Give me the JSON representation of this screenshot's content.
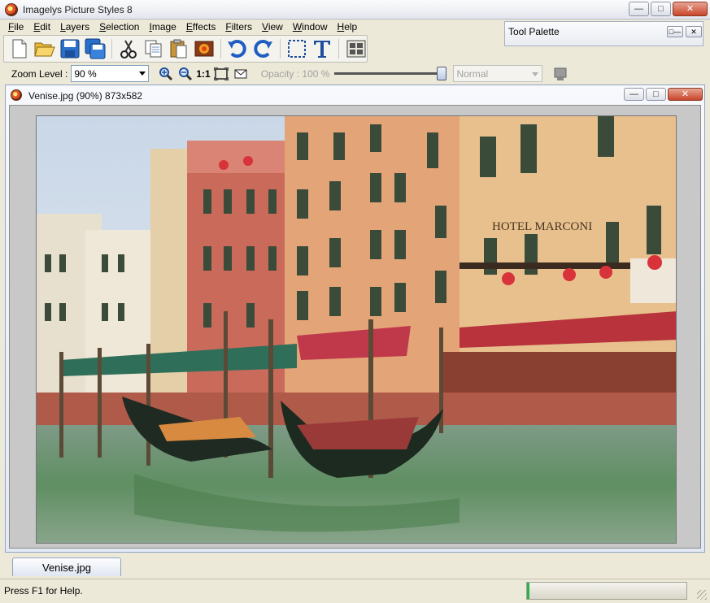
{
  "app": {
    "title": "Imagelys Picture Styles 8",
    "icon": "app-logo-icon"
  },
  "menu": [
    {
      "label": "File",
      "underline": "F",
      "rest": "ile"
    },
    {
      "label": "Edit",
      "underline": "E",
      "rest": "dit"
    },
    {
      "label": "Layers",
      "underline": "L",
      "rest": "ayers"
    },
    {
      "label": "Selection",
      "underline": "S",
      "rest": "election"
    },
    {
      "label": "Image",
      "underline": "I",
      "rest": "mage"
    },
    {
      "label": "Effects",
      "underline": "E",
      "rest": "ffects"
    },
    {
      "label": "Filters",
      "underline": "F",
      "rest": "ilters"
    },
    {
      "label": "View",
      "underline": "V",
      "rest": "iew"
    },
    {
      "label": "Window",
      "underline": "W",
      "rest": "indow"
    },
    {
      "label": "Help",
      "underline": "H",
      "rest": "elp"
    }
  ],
  "palette": {
    "title": "Tool Palette"
  },
  "toolbar": {
    "buttons": [
      "new-file",
      "open-folder",
      "save",
      "save-all",
      "cut",
      "copy",
      "paste",
      "insert-image",
      "undo",
      "redo",
      "selection-rect",
      "text",
      "arrange"
    ]
  },
  "zoom": {
    "label": "Zoom Level :",
    "value": "90 %",
    "one_to_one": "1:1"
  },
  "opacity": {
    "label": "Opacity : 100 %",
    "value_percent": 100
  },
  "blend": {
    "value": "Normal"
  },
  "document": {
    "title": "Venise.jpg (90%) 873x582"
  },
  "tabs": [
    {
      "label": "Venise.jpg"
    }
  ],
  "status": {
    "text": "Press F1 for Help."
  },
  "colors": {
    "accent": "#2f66c6",
    "window_border": "#8fa3c4"
  }
}
